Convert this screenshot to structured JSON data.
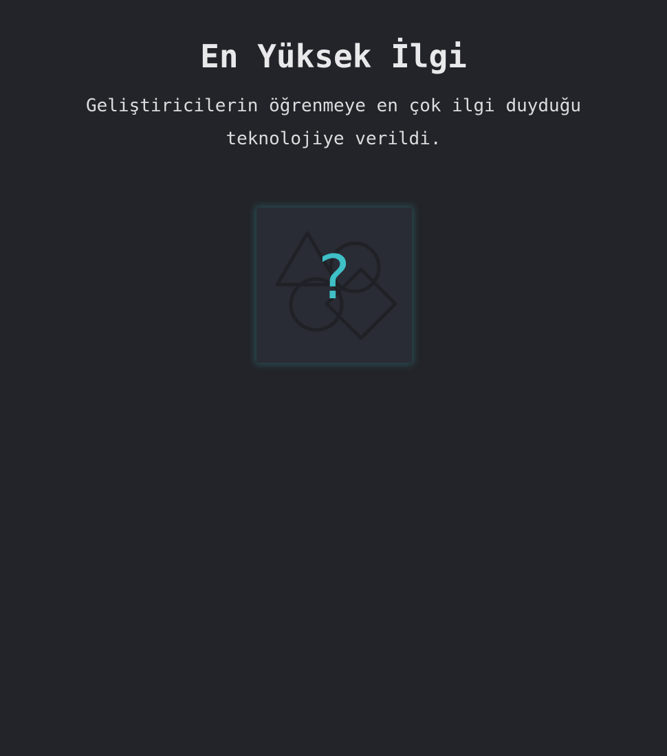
{
  "award": {
    "title": "En Yüksek İlgi",
    "description": "Geliştiricilerin öğrenmeye en çok ilgi duyduğu teknolojiye verildi."
  },
  "badge": {
    "symbol": "?",
    "icon": "mystery-shapes-icon",
    "accent_color": "#3fbfc6",
    "background_color": "#292c34"
  },
  "page": {
    "background_color": "#232429"
  }
}
